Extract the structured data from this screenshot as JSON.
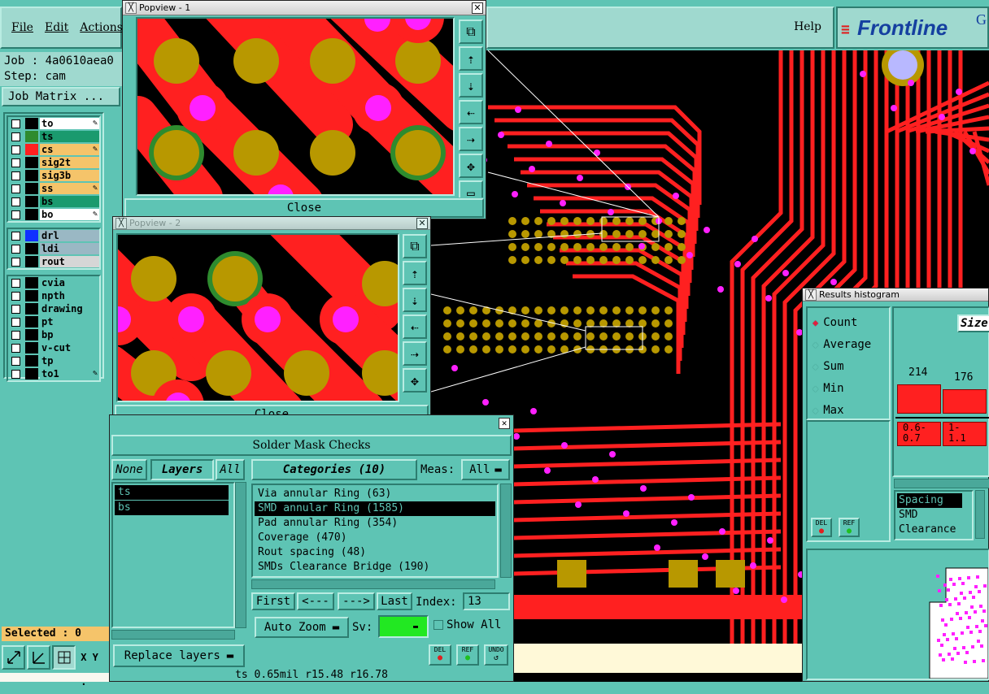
{
  "menu": {
    "file": "File",
    "edit": "Edit",
    "actions": "Actions",
    "help": "Help"
  },
  "brand": {
    "logo": "Frontline",
    "logo_suffix": "G"
  },
  "job": {
    "job_line": "Job : 4a0610aea0",
    "step_line": "Step: cam",
    "matrix_btn": "Job Matrix ..."
  },
  "layers": {
    "group1": [
      {
        "name": "to",
        "bg": "#ffffff",
        "color": "#000000",
        "mark": true
      },
      {
        "name": "ts",
        "bg": "#1a9a6e",
        "color": "#2e8b2e",
        "mark": false
      },
      {
        "name": "cs",
        "bg": "#f5c46a",
        "color": "#ff2020",
        "mark": true
      },
      {
        "name": "sig2t",
        "bg": "#f5c46a",
        "color": "",
        "mark": false
      },
      {
        "name": "sig3b",
        "bg": "#f5c46a",
        "color": "",
        "mark": false
      },
      {
        "name": "ss",
        "bg": "#f5c46a",
        "color": "",
        "mark": true
      },
      {
        "name": "bs",
        "bg": "#1a9a6e",
        "color": "",
        "mark": false
      },
      {
        "name": "bo",
        "bg": "#ffffff",
        "color": "",
        "mark": true
      }
    ],
    "group2": [
      {
        "name": "drl",
        "bg": "#9ab8c4",
        "color": "#1030ff",
        "mark": false
      },
      {
        "name": "ldi",
        "bg": "#9ab8c4",
        "color": "",
        "mark": false
      },
      {
        "name": "rout",
        "bg": "#d6d6d6",
        "color": "",
        "mark": false
      }
    ],
    "group3": [
      {
        "name": "cvia",
        "bg": "#5ec4b4",
        "color": "",
        "mark": false
      },
      {
        "name": "npth",
        "bg": "#5ec4b4",
        "color": "",
        "mark": false
      },
      {
        "name": "drawing",
        "bg": "#5ec4b4",
        "color": "",
        "mark": false
      },
      {
        "name": "pt",
        "bg": "#5ec4b4",
        "color": "",
        "mark": false
      },
      {
        "name": "bp",
        "bg": "#5ec4b4",
        "color": "",
        "mark": false
      },
      {
        "name": "v-cut",
        "bg": "#5ec4b4",
        "color": "",
        "mark": false
      },
      {
        "name": "tp",
        "bg": "#5ec4b4",
        "color": "",
        "mark": false
      },
      {
        "name": "to1",
        "bg": "#5ec4b4",
        "color": "",
        "mark": true
      }
    ]
  },
  "status": {
    "selected": "Selected : 0",
    "xy": "X Y :"
  },
  "popview1": {
    "title": "Popview - 1",
    "close": "Close"
  },
  "popview2": {
    "title": "Popview - 2",
    "close": "Close"
  },
  "smc": {
    "title": "Solder Mask Checks",
    "none": "None",
    "layers": "Layers",
    "all": "All",
    "categories_label": "Categories (10)",
    "meas_label": "Meas:",
    "meas_value": "All",
    "layer_items": [
      "ts",
      "bs"
    ],
    "categories": [
      "Via annular Ring (63)",
      "SMD annular Ring (1585)",
      "Pad annular Ring (354)",
      "Coverage (470)",
      "Rout spacing (48)",
      "SMDs Clearance Bridge (190)"
    ],
    "selected_category": 1,
    "first": "First",
    "prev": "<---",
    "next": "--->",
    "last": "Last",
    "index_label": "Index:",
    "index_value": "13",
    "auto_zoom": "Auto Zoom",
    "sv_label": "Sv:",
    "show_all": "Show All",
    "replace_layers": "Replace layers",
    "del": "DEL",
    "ref": "REF",
    "undo": "UNDO",
    "status_line": "ts 0.65mil  r15.48  r16.78"
  },
  "histogram": {
    "title": "Results histogram",
    "modes": [
      "Count",
      "Average",
      "Sum",
      "Min",
      "Max"
    ],
    "selected_mode": 0,
    "size_label": "Size",
    "bars": [
      {
        "value": "214",
        "label": "0.6-\n0.7"
      },
      {
        "value": "176",
        "label": "1-\n1.1"
      }
    ],
    "list": [
      "Spacing",
      "SMD",
      "Clearance"
    ],
    "del": "DEL",
    "ref": "REF"
  },
  "colors": {
    "accent": "#5ec4b4",
    "copper": "#ff2020",
    "pad": "#b89800",
    "via": "#ff20ff",
    "mask": "#2e8b2e",
    "board": "#000000"
  },
  "icons": [
    "zoom-fit-icon",
    "measure-icon",
    "grid-icon"
  ]
}
